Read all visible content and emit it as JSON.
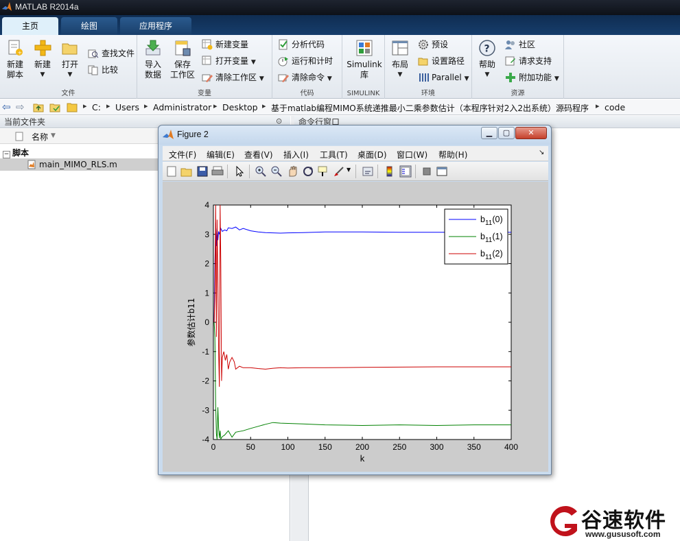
{
  "app": {
    "title": "MATLAB R2014a"
  },
  "tabs": [
    {
      "label": "主页",
      "active": true
    },
    {
      "label": "绘图",
      "active": false
    },
    {
      "label": "应用程序",
      "active": false
    }
  ],
  "ribbon": {
    "file": {
      "group_label": "文件",
      "new_script": "新建\n脚本",
      "new": "新建",
      "open": "打开",
      "find_files": "查找文件",
      "compare": "比较"
    },
    "variable": {
      "group_label": "变量",
      "import": "导入\n数据",
      "save_ws": "保存\n工作区",
      "new_var": "新建变量",
      "open_var": "打开变量",
      "clear_ws": "清除工作区"
    },
    "code": {
      "group_label": "代码",
      "analyze": "分析代码",
      "run_time": "运行和计时",
      "clear_cmd": "清除命令"
    },
    "simulink": {
      "group_label": "SIMULINK",
      "lib": "Simulink\n库"
    },
    "env": {
      "group_label": "环境",
      "layout": "布局",
      "prefs": "预设",
      "set_path": "设置路径",
      "parallel": "Parallel"
    },
    "resources": {
      "group_label": "资源",
      "help": "帮助",
      "community": "社区",
      "support": "请求支持",
      "addons": "附加功能"
    }
  },
  "address": {
    "crumbs": [
      "C:",
      "Users",
      "Administrator",
      "Desktop",
      "基于matlab编程MIMO系统递推最小二乘参数估计（本程序针对2入2出系统）源码程序",
      "code"
    ]
  },
  "current_folder": {
    "title": "当前文件夹",
    "col_name": "名称",
    "section": "脚本",
    "file": "main_MIMO_RLS.m"
  },
  "command_window": {
    "title": "命令行窗口"
  },
  "figure": {
    "title": "Figure 2",
    "menu": [
      "文件(F)",
      "编辑(E)",
      "查看(V)",
      "插入(I)",
      "工具(T)",
      "桌面(D)",
      "窗口(W)",
      "帮助(H)"
    ],
    "toolbar_icons": [
      "new-figure-icon",
      "open-file-icon",
      "save-icon",
      "print-icon",
      "pointer-icon",
      "zoom-in-icon",
      "zoom-out-icon",
      "pan-icon",
      "rotate-3d-icon",
      "data-cursor-icon",
      "brush-icon",
      "link-icon",
      "colorbar-icon",
      "legend-icon",
      "hide-tools-icon",
      "show-tools-icon"
    ]
  },
  "chart_data": {
    "type": "line",
    "title": "",
    "xlabel": "k",
    "ylabel": "参数估计b11",
    "xlim": [
      0,
      400
    ],
    "ylim": [
      -4,
      4
    ],
    "xticks": [
      0,
      50,
      100,
      150,
      200,
      250,
      300,
      350,
      400
    ],
    "yticks": [
      -4,
      -3,
      -2,
      -1,
      0,
      1,
      2,
      3,
      4
    ],
    "legend_position": "top-right",
    "grid": false,
    "series": [
      {
        "name_base": "b",
        "name_sub": "11",
        "name_suffix": "(0)",
        "color": "#0000ff",
        "x": [
          1,
          2,
          3,
          4,
          5,
          6,
          7,
          8,
          10,
          12,
          15,
          18,
          20,
          25,
          30,
          35,
          40,
          50,
          60,
          70,
          80,
          90,
          100,
          120,
          150,
          200,
          250,
          300,
          350,
          400
        ],
        "y": [
          0.0,
          2.0,
          3.4,
          2.6,
          3.2,
          2.8,
          3.1,
          3.0,
          3.2,
          3.1,
          3.15,
          3.12,
          3.22,
          3.2,
          3.25,
          3.15,
          3.2,
          3.12,
          3.08,
          3.06,
          3.05,
          3.04,
          3.05,
          3.06,
          3.08,
          3.08,
          3.07,
          3.07,
          3.07,
          3.07
        ]
      },
      {
        "name_base": "b",
        "name_sub": "11",
        "name_suffix": "(1)",
        "color": "#008000",
        "x": [
          1,
          2,
          3,
          4,
          5,
          6,
          7,
          8,
          9,
          10,
          12,
          15,
          20,
          25,
          30,
          40,
          50,
          60,
          70,
          80,
          90,
          100,
          120,
          150,
          200,
          250,
          300,
          350,
          400
        ],
        "y": [
          0.0,
          -0.5,
          -2.8,
          -3.8,
          -4.0,
          -2.9,
          -3.6,
          -3.95,
          -3.7,
          -3.98,
          -3.9,
          -3.85,
          -3.7,
          -3.92,
          -3.75,
          -3.7,
          -3.62,
          -3.55,
          -3.48,
          -3.42,
          -3.44,
          -3.45,
          -3.47,
          -3.5,
          -3.52,
          -3.5,
          -3.52,
          -3.5,
          -3.5
        ]
      },
      {
        "name_base": "b",
        "name_sub": "11",
        "name_suffix": "(2)",
        "color": "#cc0000",
        "x": [
          1,
          2,
          3,
          4,
          5,
          6,
          7,
          8,
          9,
          10,
          11,
          12,
          14,
          16,
          18,
          20,
          22,
          25,
          28,
          30,
          35,
          40,
          50,
          60,
          70,
          80,
          90,
          100,
          120,
          150,
          200,
          250,
          300,
          350,
          400
        ],
        "y": [
          0.0,
          1.0,
          4.0,
          -0.5,
          3.5,
          1.5,
          -1.0,
          -2.2,
          4.0,
          2.0,
          -2.0,
          -1.2,
          -1.0,
          -1.3,
          -1.1,
          -1.6,
          -1.35,
          -1.2,
          -1.35,
          -1.6,
          -1.5,
          -1.55,
          -1.55,
          -1.58,
          -1.6,
          -1.57,
          -1.55,
          -1.56,
          -1.55,
          -1.55,
          -1.54,
          -1.53,
          -1.52,
          -1.52,
          -1.52
        ]
      }
    ]
  },
  "watermark": {
    "brand": "谷速软件",
    "url": "www.gususoft.com",
    "accent": "#c0121b"
  }
}
